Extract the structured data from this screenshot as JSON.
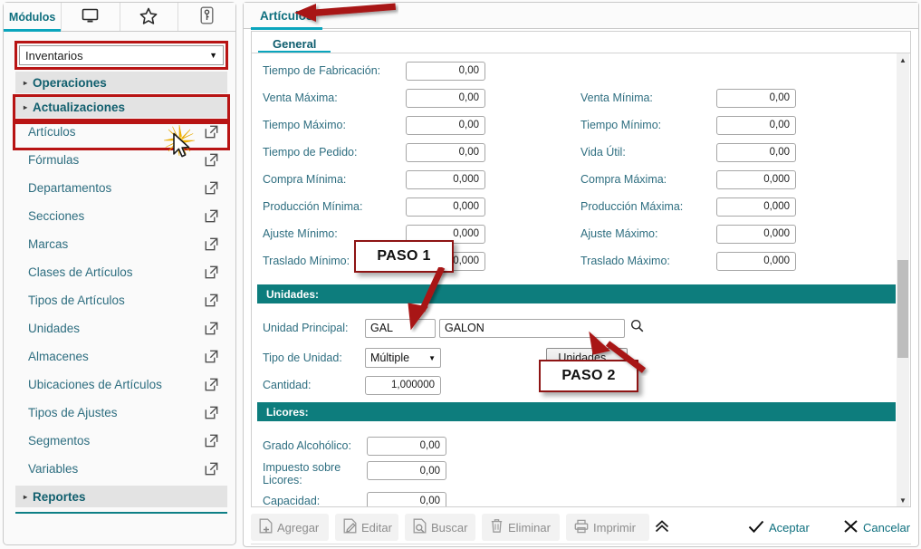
{
  "sidebar": {
    "tabs": [
      {
        "label": "Módulos",
        "icon": "modules-text",
        "active": true
      },
      {
        "label": "",
        "icon": "monitor-icon",
        "active": false
      },
      {
        "label": "",
        "icon": "star-icon",
        "active": false
      },
      {
        "label": "",
        "icon": "key-icon",
        "active": false
      }
    ],
    "module_select": {
      "value": "Inventarios",
      "caret": "▼"
    },
    "groups": [
      {
        "label": "Operaciones",
        "tri": "▸"
      },
      {
        "label": "Actualizaciones",
        "tri": "▸"
      }
    ],
    "items": [
      {
        "label": "Artículos"
      },
      {
        "label": "Fórmulas"
      },
      {
        "label": "Departamentos"
      },
      {
        "label": "Secciones"
      },
      {
        "label": "Marcas"
      },
      {
        "label": "Clases de Artículos"
      },
      {
        "label": "Tipos de Artículos"
      },
      {
        "label": "Unidades"
      },
      {
        "label": "Almacenes"
      },
      {
        "label": "Ubicaciones de Artículos"
      },
      {
        "label": "Tipos de Ajustes"
      },
      {
        "label": "Segmentos"
      },
      {
        "label": "Variables"
      }
    ],
    "reportes": {
      "label": "Reportes",
      "tri": "▸"
    }
  },
  "main": {
    "doc_tab": "Artículos",
    "general_tab": "General",
    "left_fields": [
      {
        "label": "Tiempo de Fabricación:",
        "value": "0,00"
      },
      {
        "label": "Venta Máxima:",
        "value": "0,00"
      },
      {
        "label": "Tiempo Máximo:",
        "value": "0,00"
      },
      {
        "label": "Tiempo de Pedido:",
        "value": "0,00"
      },
      {
        "label": "Compra Mínima:",
        "value": "0,000"
      },
      {
        "label": "Producción Mínima:",
        "value": "0,000"
      },
      {
        "label": "Ajuste Mínimo:",
        "value": "0,000"
      },
      {
        "label": "Traslado Mínimo:",
        "value": "0,000"
      }
    ],
    "right_fields": [
      {
        "label": "Venta Mínima:",
        "value": "0,00"
      },
      {
        "label": "Tiempo Mínimo:",
        "value": "0,00"
      },
      {
        "label": "Vida Útil:",
        "value": "0,00"
      },
      {
        "label": "Compra Máxima:",
        "value": "0,000"
      },
      {
        "label": "Producción Máxima:",
        "value": "0,000"
      },
      {
        "label": "Ajuste Máximo:",
        "value": "0,000"
      },
      {
        "label": "Traslado Máximo:",
        "value": "0,000"
      }
    ],
    "unidades": {
      "section_title": "Unidades:",
      "unidad_principal_label": "Unidad Principal:",
      "unidad_code": "GAL",
      "unidad_name": "GALON",
      "tipo_label": "Tipo de Unidad:",
      "tipo_value": "Múltiple",
      "tipo_caret": "▼",
      "unidades_button": "Unidades...",
      "cantidad_label": "Cantidad:",
      "cantidad_value": "1,000000"
    },
    "licores": {
      "section_title": "Licores:",
      "fields": [
        {
          "label": "Grado Alcohólico:",
          "value": "0,00"
        },
        {
          "label": "Impuesto sobre Licores:",
          "value": "0,00"
        },
        {
          "label": "Capacidad:",
          "value": "0,00"
        }
      ]
    },
    "toolbar": [
      {
        "label": "Agregar",
        "icon": "add-document-icon"
      },
      {
        "label": "Editar",
        "icon": "edit-document-icon"
      },
      {
        "label": "Buscar",
        "icon": "search-document-icon"
      },
      {
        "label": "Eliminar",
        "icon": "trash-icon"
      },
      {
        "label": "Imprimir",
        "icon": "printer-icon"
      }
    ],
    "toolbar_expand": "⌃⌃",
    "accept_label": "Aceptar",
    "accept_icon": "check-icon",
    "cancel_label": "Cancelar",
    "cancel_icon": "x-icon"
  },
  "annotations": {
    "paso1": "PASO 1",
    "paso2": "PASO 2",
    "highlight_color": "#b81414",
    "arrow_color": "#b01414",
    "teal": "#0d7d7d",
    "accent": "#0aa5bd"
  }
}
